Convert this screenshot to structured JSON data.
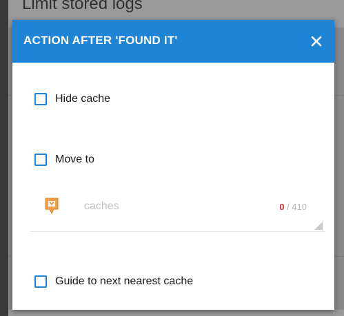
{
  "background": {
    "title": "Limit stored logs"
  },
  "dialog": {
    "title": "ACTION AFTER 'FOUND IT'",
    "close_icon": "close-icon",
    "options": {
      "hide_cache": {
        "label": "Hide cache",
        "checked": false
      },
      "move_to": {
        "label": "Move to",
        "checked": false
      },
      "guide_next": {
        "label": "Guide to next nearest cache",
        "checked": false
      }
    },
    "folder": {
      "icon": "geocache-folder-icon",
      "name": "caches",
      "selected_count": "0",
      "total_count": "/ 410"
    }
  },
  "colors": {
    "accent": "#1f84d6",
    "count_highlight": "#d32f2f",
    "folder_icon": "#f0a04b"
  }
}
